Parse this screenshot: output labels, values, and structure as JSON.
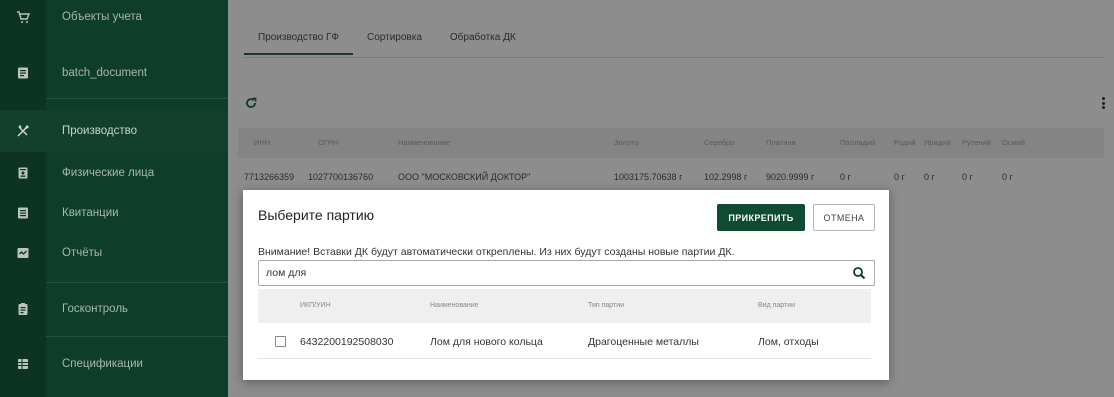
{
  "sidebar": {
    "items": [
      {
        "label": "Объекты учета",
        "icon": "cart-icon"
      },
      {
        "label": "batch_document",
        "icon": "document-icon"
      },
      {
        "label": "Производство",
        "icon": "tools-icon"
      },
      {
        "label": "Физические лица",
        "icon": "id-card-icon"
      },
      {
        "label": "Квитанции",
        "icon": "receipt-icon"
      },
      {
        "label": "Отчёты",
        "icon": "report-icon"
      },
      {
        "label": "Госконтроль",
        "icon": "clipboard-icon"
      },
      {
        "label": "Спецификации",
        "icon": "table-icon"
      }
    ]
  },
  "tabs": [
    "Производство ГФ",
    "Сортировка",
    "Обработка ДК"
  ],
  "table": {
    "headers": [
      "ИНН",
      "ОГРН",
      "Наименование",
      "Золото",
      "Серебро",
      "Платина",
      "Палладий",
      "Родий",
      "Иридий",
      "Рутений",
      "Осмий"
    ],
    "row": [
      "7713266359",
      "1027700136760",
      "ООО \"МОСКОВСКИЙ ДОКТОР\"",
      "1003175.70638 г",
      "102.2998 г",
      "9020.9999 г",
      "0 г",
      "0 г",
      "0 г",
      "0 г",
      "0 г"
    ]
  },
  "dialog": {
    "title": "Выберите партию",
    "attach_label": "ПРИКРЕПИТЬ",
    "cancel_label": "ОТМЕНА",
    "note": "Внимание! Вставки ДК будут автоматически откреплены. Из них будут созданы новые партии ДК.",
    "search_value": "лом для",
    "headers": [
      "ИКП/УИН",
      "Наименование",
      "Тип партии",
      "Вид партии"
    ],
    "rows": [
      [
        "6432200192508030",
        "Лом для нового кольца",
        "Драгоценные металлы",
        "Лом, отходы"
      ]
    ]
  },
  "colors": {
    "sidebar": "#0f3d2b",
    "primary_button": "#0f4a33",
    "overlay": "#8f8f8f"
  }
}
